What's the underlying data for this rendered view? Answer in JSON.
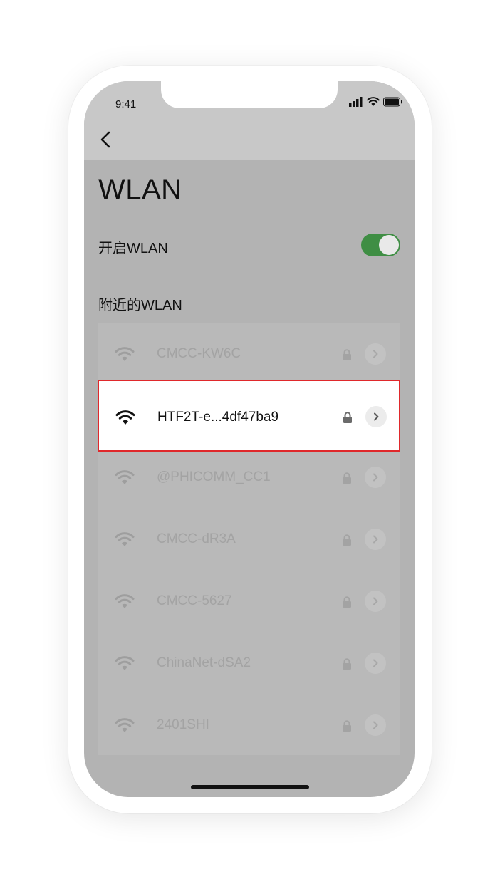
{
  "status_bar": {
    "time": "9:41"
  },
  "page": {
    "title": "WLAN",
    "toggle_label": "开启WLAN",
    "toggle_state": "on",
    "section_label": "附近的WLAN"
  },
  "networks": [
    {
      "ssid": "CMCC-KW6C"
    },
    {
      "ssid": "HTF2T-e...4df47ba9",
      "highlighted": true
    },
    {
      "ssid": "@PHICOMM_CC1"
    },
    {
      "ssid": "CMCC-dR3A"
    },
    {
      "ssid": "CMCC-5627"
    },
    {
      "ssid": "ChinaNet-dSA2"
    },
    {
      "ssid": "2401SHI"
    }
  ],
  "icons": {
    "back": "chevron-left-icon",
    "wifi": "wifi-icon",
    "lock": "lock-icon",
    "detail": "chevron-right-icon"
  },
  "colors": {
    "toggle_on": "#3f8e44",
    "highlight_border": "#e0282b"
  }
}
